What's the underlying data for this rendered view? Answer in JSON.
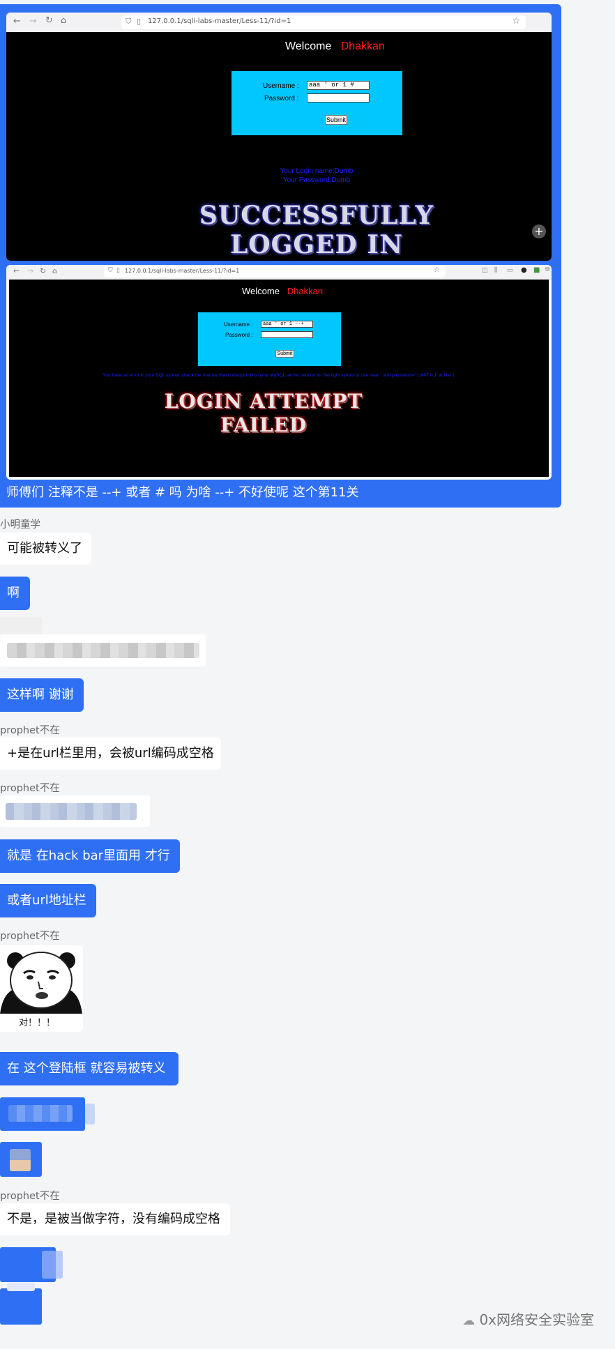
{
  "screenshot1": {
    "url": "127.0.0.1/sqli-labs-master/Less-11/?id=1",
    "welcome": "Welcome",
    "username_name": "Dhakkan",
    "username_label": "Username :",
    "password_label": "Password :",
    "username_value": "aaa ' or 1 #",
    "password_value": "",
    "submit_label": "Submit",
    "login_name_line": "Your Login name:Dumb",
    "password_line": "Your Password:Dumb",
    "result_line1": "SUCCESSFULLY",
    "result_line2": "LOGGED IN"
  },
  "screenshot2": {
    "url": "127.0.0.1/sqli-labs-master/Less-11/?id=1",
    "welcome": "Welcome",
    "username_name": "Dhakkan",
    "username_label": "Username :",
    "password_label": "Password :",
    "username_value": "aaa ' or 1 --+",
    "password_value": "",
    "submit_label": "Submit",
    "error_line": "You have an error in your SQL syntax; check the manual that corresponds to your MySQL server version for the right syntax to use near '' and password='' LIMIT 0,1' at line 1",
    "result_line1": "LOGIN ATTEMPT",
    "result_line2": "FAILED"
  },
  "messages": {
    "m1_caption": "师傅们 注释不是 --+  或者 # 吗 为啥 --+ 不好使呢  这个第11关",
    "m2_sender": "小明童学",
    "m2_text": "可能被转义了",
    "m3_text": "啊",
    "m5_text": "这样啊 谢谢",
    "m6_sender": "prophet不在",
    "m6_text": "+是在url栏里用，会被url编码成空格",
    "m7_sender": "prophet不在",
    "m8_text": "就是 在hack bar里面用  才行",
    "m9_text": "或者url地址栏",
    "m10_sender": "prophet不在",
    "m10_sticker_caption": "对！！！",
    "m11_text": "在 这个登陆框  就容易被转义",
    "m14_sender": "prophet不在",
    "m14_text": "不是，是被当做字符，没有编码成空格"
  },
  "watermark": "0x网络安全实验室",
  "colors": {
    "outgoing_bubble": "#2f6ff3",
    "incoming_bubble": "#ffffff",
    "background": "#f4f5f7",
    "login_box": "#00c8ff",
    "name_red": "#ff1c1c"
  }
}
